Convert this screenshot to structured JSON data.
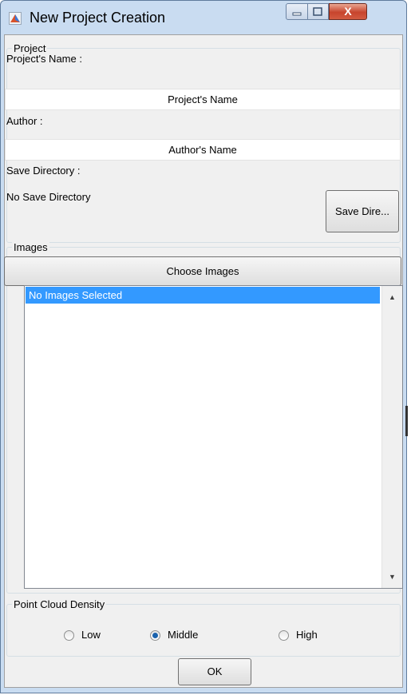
{
  "window": {
    "title": "New Project Creation",
    "close_glyph": "X"
  },
  "project_group": {
    "legend": "Project",
    "name_label": "Project's Name :",
    "name_value": "Project's Name",
    "author_label": "Author :",
    "author_value": "Author's Name",
    "save_dir_label": "Save Directory :",
    "save_dir_value": "No Save Directory",
    "save_dir_button": "Save Dire..."
  },
  "images_group": {
    "legend": "Images",
    "choose_button": "Choose Images",
    "list_items": [
      "No Images Selected"
    ],
    "scroll_up": "▲",
    "scroll_down": "▼"
  },
  "density_group": {
    "legend": "Point Cloud Density",
    "options": [
      {
        "label": "Low",
        "checked": false
      },
      {
        "label": "Middle",
        "checked": true
      },
      {
        "label": "High",
        "checked": false
      }
    ]
  },
  "ok_button": "OK",
  "colors": {
    "selection": "#3399ff",
    "frame": "#c9dcf1",
    "close_button": "#c7442d"
  }
}
